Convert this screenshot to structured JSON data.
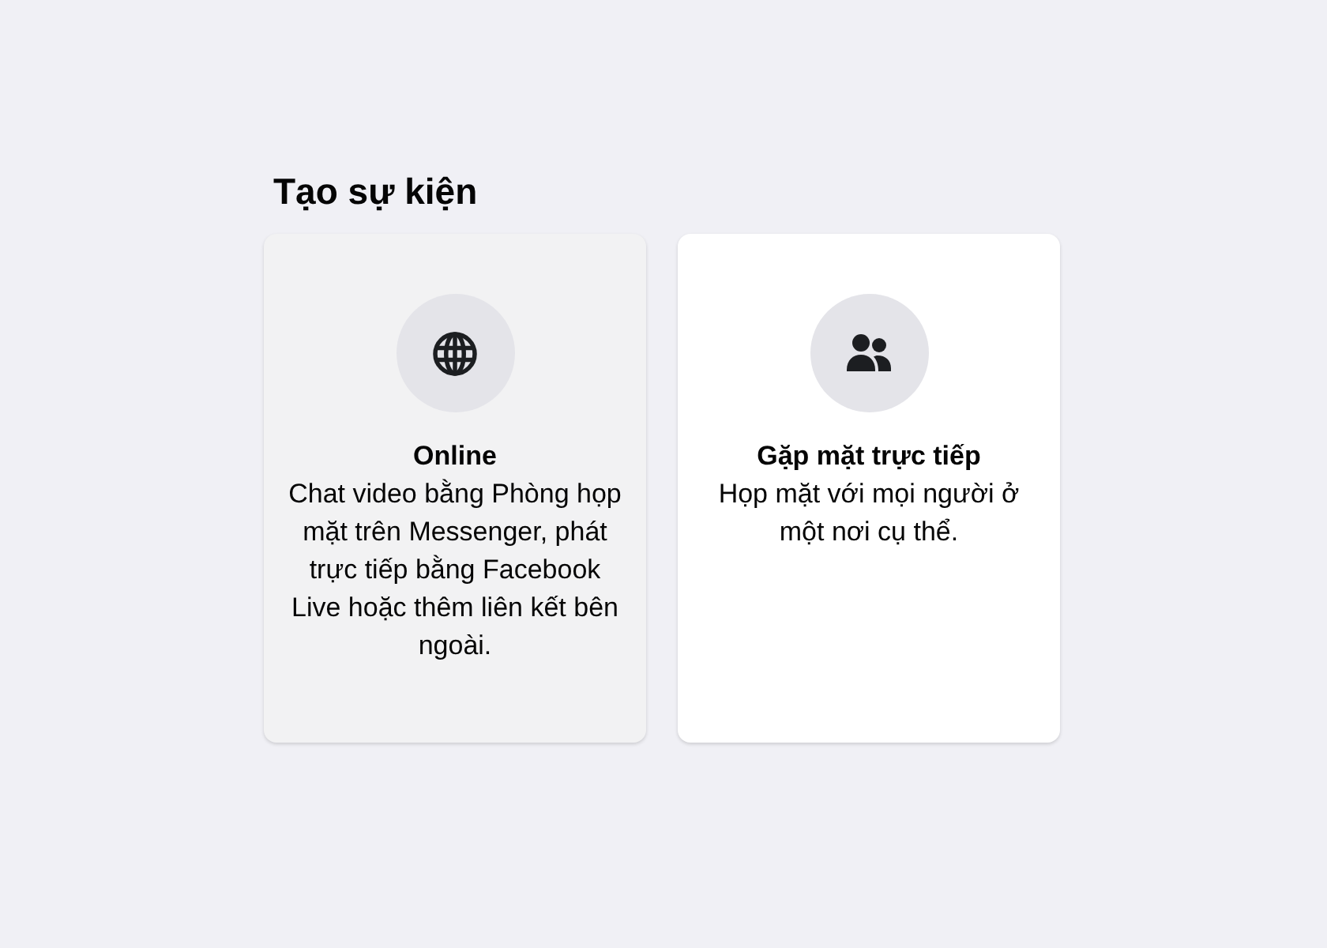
{
  "title": "Tạo sự kiện",
  "options": [
    {
      "kind": "online",
      "title": "Online",
      "description": "Chat video bằng Phòng họp mặt trên Messenger, phát trực tiếp bằng Facebook Live hoặc thêm liên kết bên ngoài.",
      "selected": true
    },
    {
      "kind": "in-person",
      "title": "Gặp mặt trực tiếp",
      "description": "Họp mặt với mọi người ở một nơi cụ thể.",
      "selected": false
    }
  ]
}
